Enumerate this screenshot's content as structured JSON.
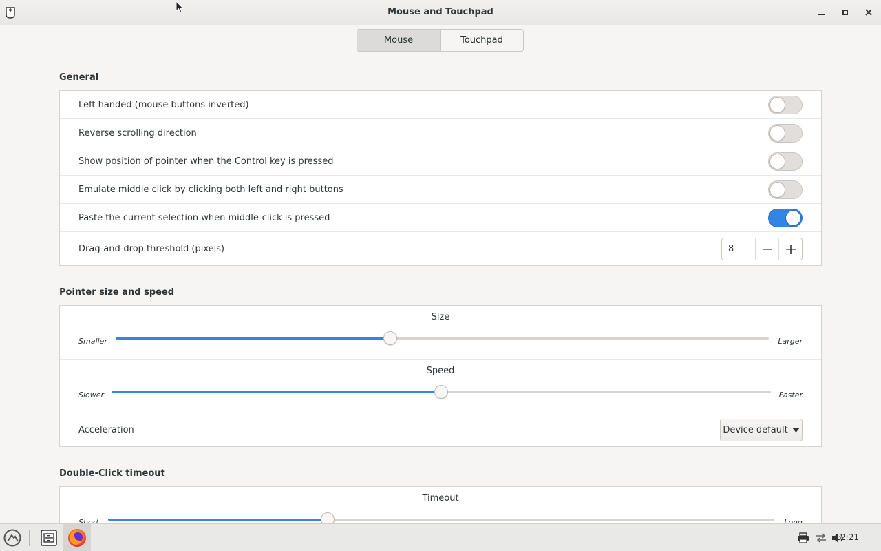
{
  "window": {
    "title": "Mouse and Touchpad"
  },
  "tabs": [
    {
      "label": "Mouse",
      "active": true
    },
    {
      "label": "Touchpad",
      "active": false
    }
  ],
  "general": {
    "title": "General",
    "rows": [
      {
        "label": "Left handed (mouse buttons inverted)",
        "on": false
      },
      {
        "label": "Reverse scrolling direction",
        "on": false
      },
      {
        "label": "Show position of pointer when the Control key is pressed",
        "on": false
      },
      {
        "label": "Emulate middle click by clicking both left and right buttons",
        "on": false
      },
      {
        "label": "Paste the current selection when middle-click is pressed",
        "on": true
      }
    ],
    "threshold": {
      "label": "Drag-and-drop threshold (pixels)",
      "value": "8"
    }
  },
  "pointer": {
    "title": "Pointer size and speed",
    "size": {
      "title": "Size",
      "min_label": "Smaller",
      "max_label": "Larger",
      "value": 0.42
    },
    "speed": {
      "title": "Speed",
      "min_label": "Slower",
      "max_label": "Faster",
      "value": 0.5
    },
    "acceleration": {
      "label": "Acceleration",
      "selected": "Device default"
    }
  },
  "double_click": {
    "title": "Double-Click timeout",
    "timeout": {
      "title": "Timeout",
      "min_label": "Short",
      "max_label": "Long",
      "value": 0.33
    }
  },
  "taskbar": {
    "clock": "12:21",
    "icons": [
      "menu-icon",
      "file-manager-icon",
      "firefox-icon",
      "printer-icon",
      "network-icon",
      "volume-icon"
    ]
  },
  "colors": {
    "accent": "#3584e4",
    "background": "#f6f5f4",
    "frame": "#ffffff"
  }
}
